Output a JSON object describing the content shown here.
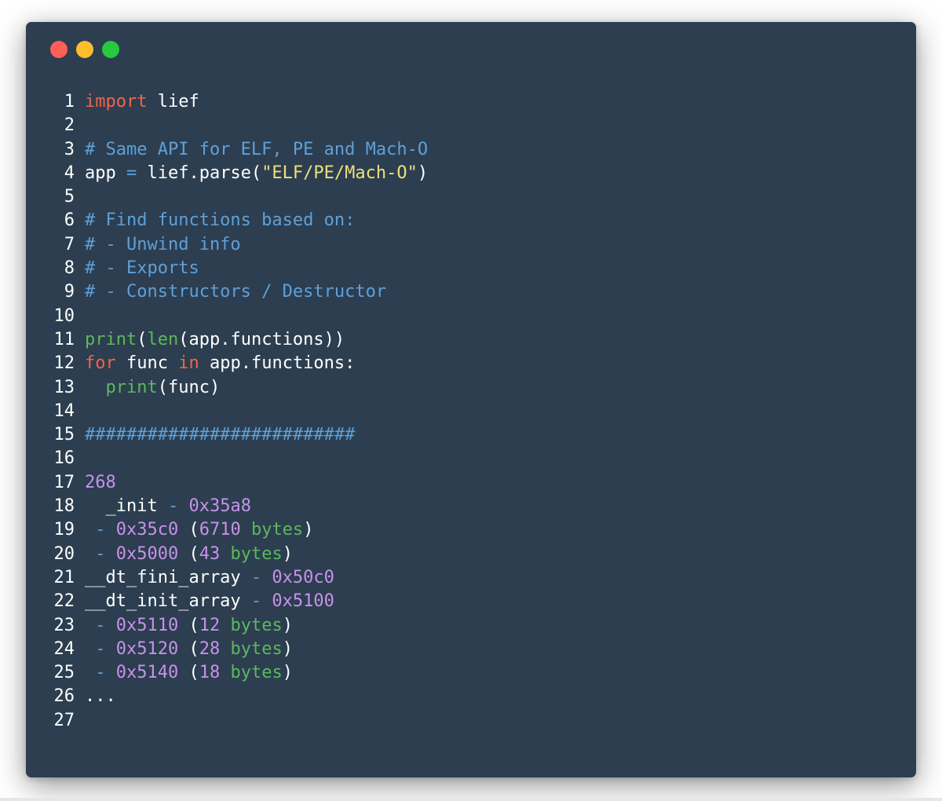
{
  "window": {
    "controls": [
      {
        "name": "close",
        "color": "#ff5f56"
      },
      {
        "name": "minimize",
        "color": "#ffbd2e"
      },
      {
        "name": "maximize",
        "color": "#27c93f"
      }
    ]
  },
  "code": {
    "lines": [
      [
        {
          "t": "import",
          "c": "kw"
        },
        {
          "t": " lief",
          "c": "pl"
        }
      ],
      [],
      [
        {
          "t": "# Same API for ELF, PE and Mach-O",
          "c": "cm"
        }
      ],
      [
        {
          "t": "app ",
          "c": "pl"
        },
        {
          "t": "=",
          "c": "op"
        },
        {
          "t": " lief.parse(",
          "c": "pl"
        },
        {
          "t": "\"ELF/PE/Mach-O\"",
          "c": "st"
        },
        {
          "t": ")",
          "c": "pl"
        }
      ],
      [],
      [
        {
          "t": "# Find functions based on:",
          "c": "cm"
        }
      ],
      [
        {
          "t": "# - Unwind info",
          "c": "cm"
        }
      ],
      [
        {
          "t": "# - Exports",
          "c": "cm"
        }
      ],
      [
        {
          "t": "# - Constructors / Destructor",
          "c": "cm"
        }
      ],
      [],
      [
        {
          "t": "print",
          "c": "fn"
        },
        {
          "t": "(",
          "c": "pl"
        },
        {
          "t": "len",
          "c": "fn"
        },
        {
          "t": "(app.functions))",
          "c": "pl"
        }
      ],
      [
        {
          "t": "for",
          "c": "kw"
        },
        {
          "t": " func ",
          "c": "pl"
        },
        {
          "t": "in",
          "c": "kw"
        },
        {
          "t": " app.functions:",
          "c": "pl"
        }
      ],
      [
        {
          "t": "  ",
          "c": "pl"
        },
        {
          "t": "print",
          "c": "fn"
        },
        {
          "t": "(func)",
          "c": "pl"
        }
      ],
      [],
      [
        {
          "t": "##########################",
          "c": "cm"
        }
      ],
      [],
      [
        {
          "t": "268",
          "c": "num"
        }
      ],
      [
        {
          "t": "  _init ",
          "c": "pl"
        },
        {
          "t": "-",
          "c": "op"
        },
        {
          "t": " 0x35a8",
          "c": "num"
        }
      ],
      [
        {
          "t": " ",
          "c": "pl"
        },
        {
          "t": "-",
          "c": "op"
        },
        {
          "t": " 0x35c0",
          "c": "num"
        },
        {
          "t": " (",
          "c": "pl"
        },
        {
          "t": "6710",
          "c": "num"
        },
        {
          "t": " bytes",
          "c": "fn"
        },
        {
          "t": ")",
          "c": "pl"
        }
      ],
      [
        {
          "t": " ",
          "c": "pl"
        },
        {
          "t": "-",
          "c": "op"
        },
        {
          "t": " 0x5000",
          "c": "num"
        },
        {
          "t": " (",
          "c": "pl"
        },
        {
          "t": "43",
          "c": "num"
        },
        {
          "t": " bytes",
          "c": "fn"
        },
        {
          "t": ")",
          "c": "pl"
        }
      ],
      [
        {
          "t": "__dt_fini_array ",
          "c": "pl"
        },
        {
          "t": "-",
          "c": "op"
        },
        {
          "t": " 0x50c0",
          "c": "num"
        }
      ],
      [
        {
          "t": "__dt_init_array ",
          "c": "pl"
        },
        {
          "t": "-",
          "c": "op"
        },
        {
          "t": " 0x5100",
          "c": "num"
        }
      ],
      [
        {
          "t": " ",
          "c": "pl"
        },
        {
          "t": "-",
          "c": "op"
        },
        {
          "t": " 0x5110",
          "c": "num"
        },
        {
          "t": " (",
          "c": "pl"
        },
        {
          "t": "12",
          "c": "num"
        },
        {
          "t": " bytes",
          "c": "fn"
        },
        {
          "t": ")",
          "c": "pl"
        }
      ],
      [
        {
          "t": " ",
          "c": "pl"
        },
        {
          "t": "-",
          "c": "op"
        },
        {
          "t": " 0x5120",
          "c": "num"
        },
        {
          "t": " (",
          "c": "pl"
        },
        {
          "t": "28",
          "c": "num"
        },
        {
          "t": " bytes",
          "c": "fn"
        },
        {
          "t": ")",
          "c": "pl"
        }
      ],
      [
        {
          "t": " ",
          "c": "pl"
        },
        {
          "t": "-",
          "c": "op"
        },
        {
          "t": " 0x5140",
          "c": "num"
        },
        {
          "t": " (",
          "c": "pl"
        },
        {
          "t": "18",
          "c": "num"
        },
        {
          "t": " bytes",
          "c": "fn"
        },
        {
          "t": ")",
          "c": "pl"
        }
      ],
      [
        {
          "t": "...",
          "c": "pl"
        }
      ],
      []
    ]
  }
}
